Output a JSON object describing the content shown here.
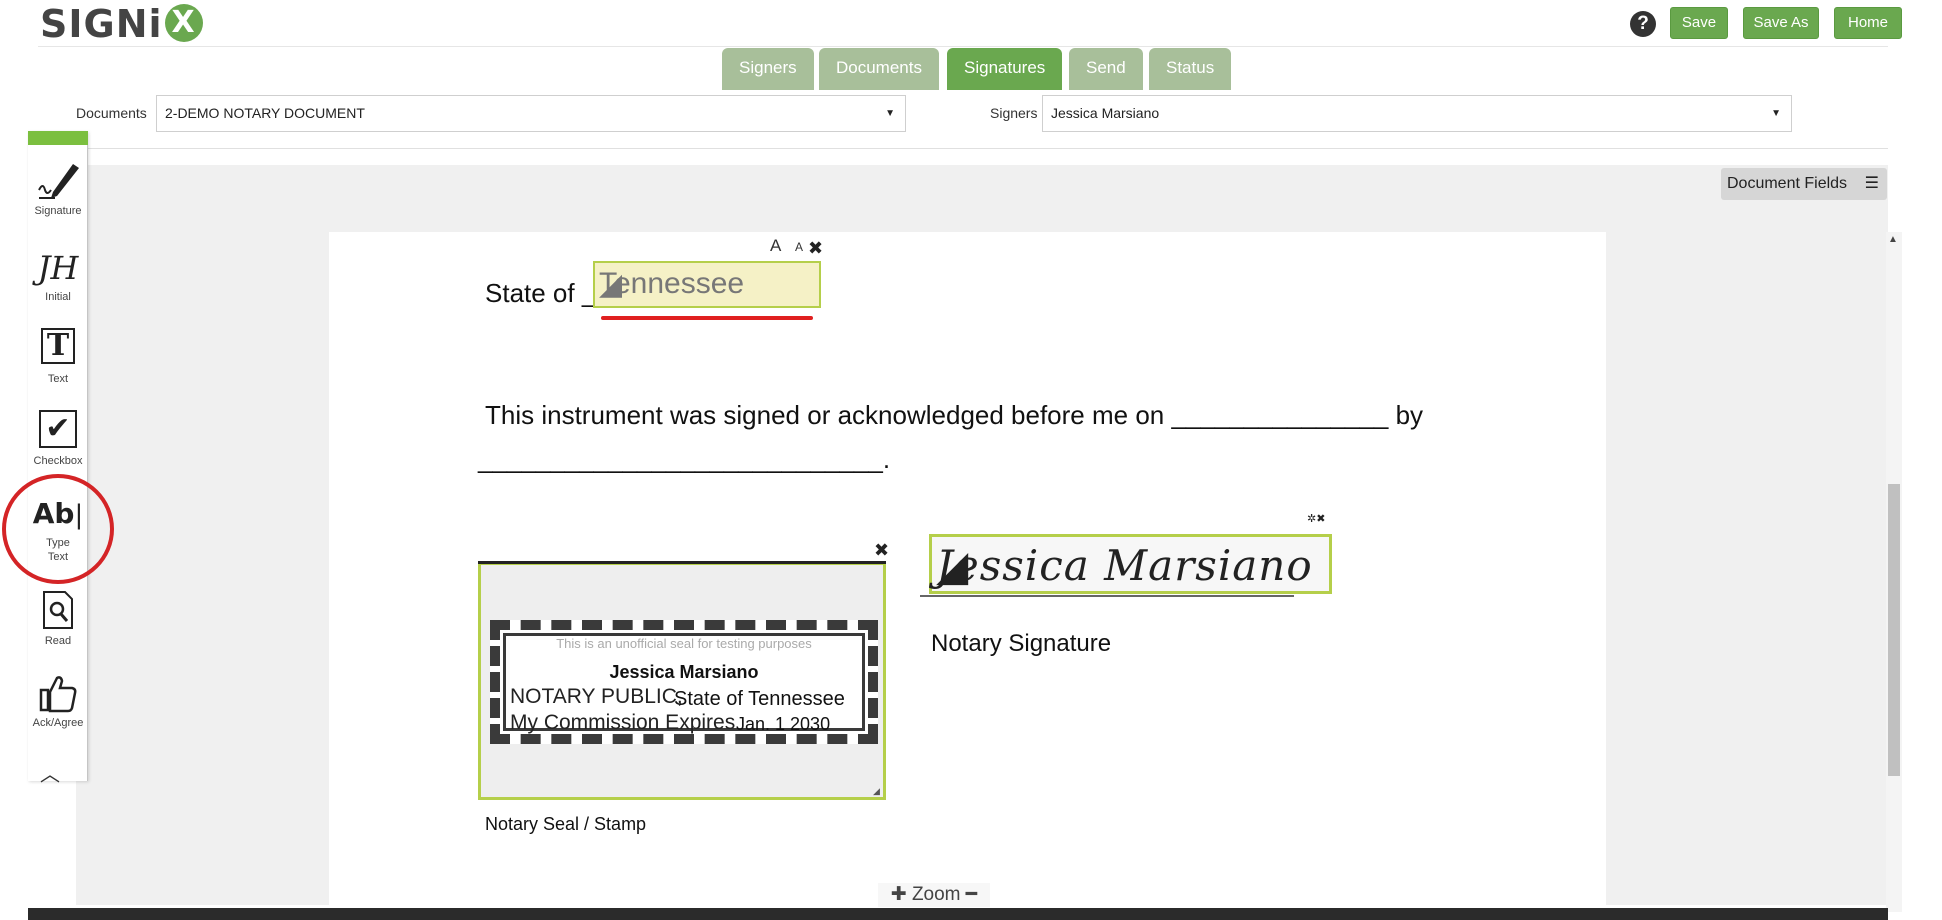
{
  "app": {
    "logo_text": "SIGNi",
    "logo_x": "X"
  },
  "header": {
    "help_label": "?",
    "save_label": "Save",
    "save_as_label": "Save As",
    "home_label": "Home"
  },
  "tabs": [
    {
      "label": "Signers"
    },
    {
      "label": "Documents"
    },
    {
      "label": "Signatures"
    },
    {
      "label": "Send"
    },
    {
      "label": "Status"
    }
  ],
  "active_tab": "Signatures",
  "selectors": {
    "documents_label": "Documents",
    "documents_value": "2-DEMO NOTARY DOCUMENT",
    "signers_label": "Signers",
    "signers_value": "Jessica Marsiano"
  },
  "document_fields_label": "Document Fields",
  "palette": {
    "tools": [
      {
        "label": "Signature",
        "icon": "pen-icon"
      },
      {
        "label": "Initial",
        "icon": "initial-icon",
        "glyph": "JH"
      },
      {
        "label": "Text",
        "icon": "text-icon",
        "glyph": "T"
      },
      {
        "label": "Checkbox",
        "icon": "checkbox-icon",
        "glyph": "✔"
      },
      {
        "label": "Type Text",
        "label_line1": "Type",
        "label_line2": "Text",
        "icon": "type-text-icon",
        "glyph": "Ab"
      },
      {
        "label": "Read",
        "icon": "read-icon"
      },
      {
        "label": "Ack/Agree",
        "icon": "thumbs-up-icon"
      }
    ]
  },
  "document": {
    "state_of": "State of _",
    "state_value": "Tennessee",
    "font_big": "A",
    "font_small": "A",
    "instrument_text": "This instrument was signed or acknowledged before me on _______________ by",
    "blank_line": "____________________________.",
    "seal": {
      "note": "This is an unofficial seal for testing purposes",
      "name": "Jessica Marsiano",
      "notary_public": "NOTARY PUBLIC,",
      "state": "State of Tennessee",
      "expires": "My Commission Expires",
      "date": "Jan. 1 2030"
    },
    "seal_caption": "Notary Seal / Stamp",
    "signature_value": "Jessica Marsiano",
    "signature_caption": "Notary Signature"
  },
  "zoom_label": "Zoom",
  "colors": {
    "brand_green": "#6aa84f",
    "tab_inactive": "#a8bf9a",
    "field_border": "#b5cf4a",
    "field_fill": "#f5f1c6",
    "highlight_red": "#d42426"
  }
}
